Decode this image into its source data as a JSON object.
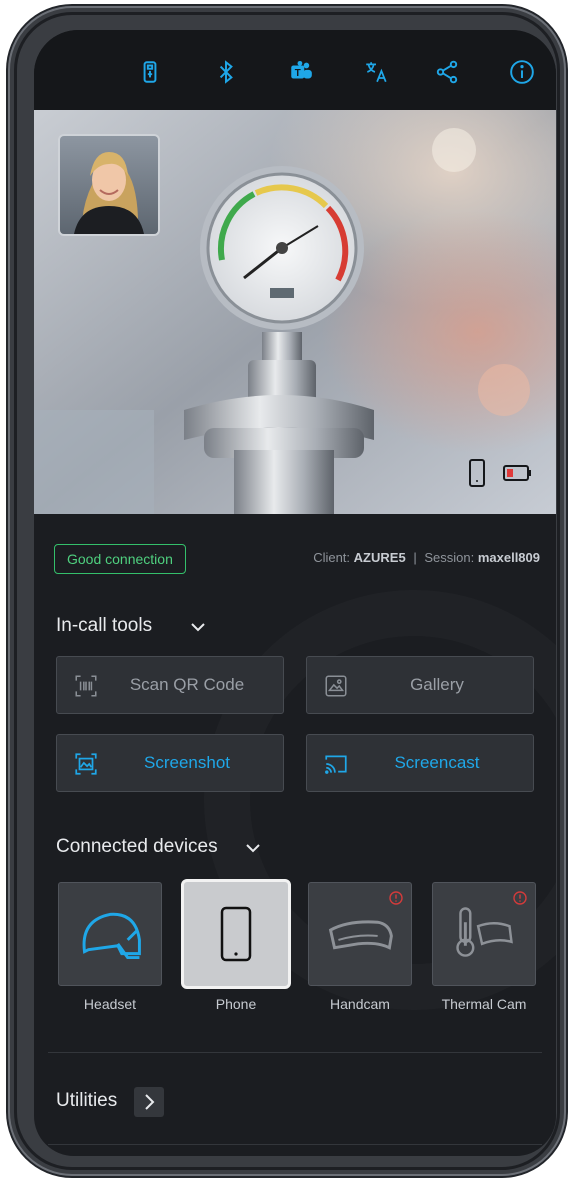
{
  "colors": {
    "accent": "#1fa7e8",
    "good": "#34c06b",
    "alert": "#d33b3b"
  },
  "topbar": {
    "icons": [
      "usb-icon",
      "bluetooth-icon",
      "teams-icon",
      "translate-icon",
      "share-icon",
      "info-icon"
    ]
  },
  "status": {
    "connection": "Good connection",
    "client_label": "Client:",
    "client_value": "AZURE5",
    "separator": "|",
    "session_label": "Session:",
    "session_value": "maxell809"
  },
  "tools": {
    "title": "In-call tools",
    "buttons": [
      {
        "label": "Scan QR Code",
        "enabled": false
      },
      {
        "label": "Gallery",
        "enabled": false
      },
      {
        "label": "Screenshot",
        "enabled": true
      },
      {
        "label": "Screencast",
        "enabled": true
      }
    ]
  },
  "devices": {
    "title": "Connected devices",
    "items": [
      {
        "label": "Headset",
        "state": "connected"
      },
      {
        "label": "Phone",
        "state": "selected"
      },
      {
        "label": "Handcam",
        "state": "unavailable"
      },
      {
        "label": "Thermal Cam",
        "state": "unavailable"
      }
    ]
  },
  "utilities": {
    "title": "Utilities"
  }
}
